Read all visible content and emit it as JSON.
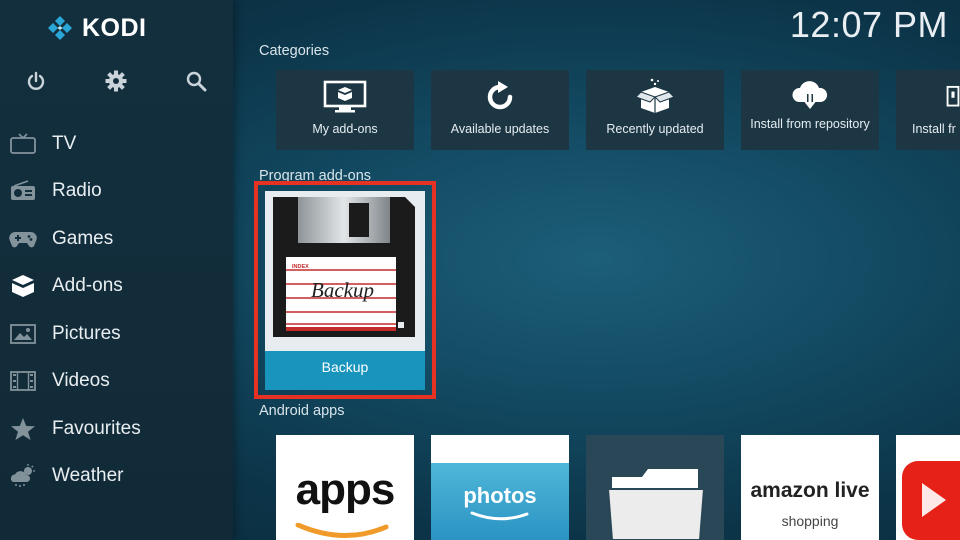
{
  "app": {
    "logo_text": "KODI"
  },
  "clock": "12:07 PM",
  "top_icons": [
    "power-icon",
    "gear-icon",
    "search-icon"
  ],
  "sidebar": {
    "items": [
      {
        "label": "TV",
        "icon": "tv-icon"
      },
      {
        "label": "Radio",
        "icon": "radio-icon"
      },
      {
        "label": "Games",
        "icon": "gamepad-icon"
      },
      {
        "label": "Add-ons",
        "icon": "box-icon"
      },
      {
        "label": "Pictures",
        "icon": "picture-icon"
      },
      {
        "label": "Videos",
        "icon": "film-icon"
      },
      {
        "label": "Favourites",
        "icon": "star-icon"
      },
      {
        "label": "Weather",
        "icon": "weather-icon"
      }
    ],
    "active_index": 3
  },
  "sections": {
    "categories": {
      "title": "Categories",
      "tiles": [
        {
          "label": "My add-ons",
          "icon": "monitor-box-icon"
        },
        {
          "label": "Available updates",
          "icon": "refresh-icon"
        },
        {
          "label": "Recently updated",
          "icon": "open-box-icon"
        },
        {
          "label": "Install from repository",
          "icon": "cloud-download-icon"
        },
        {
          "label": "Install fr",
          "icon": "zip-icon"
        }
      ]
    },
    "program_addons": {
      "title": "Program add-ons",
      "tiles": [
        {
          "label": "Backup",
          "art_text": "Backup",
          "art_index_text": "INDEX"
        }
      ]
    },
    "android_apps": {
      "title": "Android apps",
      "tiles": [
        {
          "label": "apps",
          "brand": "amazon-appstore"
        },
        {
          "label": "photos",
          "brand": "amazon-photos"
        },
        {
          "label": "",
          "brand": "files"
        },
        {
          "label": "amazon live",
          "sub": "shopping",
          "brand": "amazon-live"
        },
        {
          "label": "",
          "brand": "youtube"
        }
      ]
    }
  },
  "colors": {
    "focus_border": "#e63222",
    "focus_tile": "#1995bd",
    "tile_bg": "#1c3644"
  }
}
